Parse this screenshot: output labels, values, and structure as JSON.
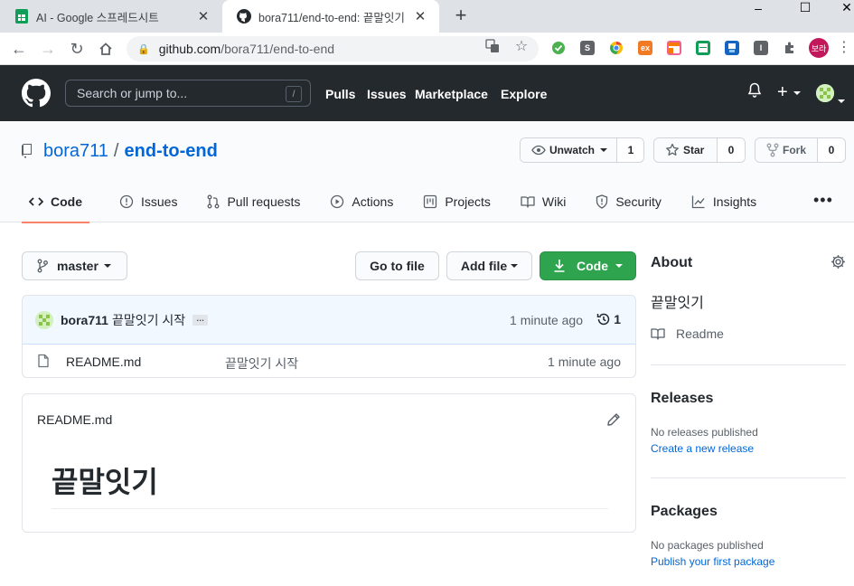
{
  "browser": {
    "tabs": [
      {
        "title": "AI - Google 스프레드시트",
        "active": false
      },
      {
        "title": "bora711/end-to-end: 끝말잇기",
        "active": true
      }
    ],
    "url_host": "github.com",
    "url_path": "/bora711/end-to-end",
    "profile_label": "보라",
    "extensions": [
      {
        "name": "ext-s-icon",
        "glyph": "S",
        "color": "#5f6368"
      },
      {
        "name": "ext-ex-icon",
        "glyph": "ex",
        "color": "#f07b24"
      },
      {
        "name": "ext-i-icon",
        "glyph": "I",
        "color": "#5f6368"
      }
    ]
  },
  "gh_header": {
    "search_placeholder": "Search or jump to...",
    "search_shortcut": "/",
    "nav": [
      "Pulls",
      "Issues",
      "Marketplace",
      "Explore"
    ]
  },
  "repo": {
    "owner": "bora711",
    "separator": "/",
    "name": "end-to-end",
    "watch_label": "Unwatch",
    "watch_count": "1",
    "star_label": "Star",
    "star_count": "0",
    "fork_label": "Fork",
    "fork_count": "0",
    "tabs": [
      "Code",
      "Issues",
      "Pull requests",
      "Actions",
      "Projects",
      "Wiki",
      "Security",
      "Insights"
    ]
  },
  "toolbar": {
    "branch": "master",
    "go_to_file": "Go to file",
    "add_file": "Add file",
    "code": "Code"
  },
  "commit": {
    "user": "bora711",
    "message": "끝말잇기 시작",
    "ellipsis": "…",
    "time": "1 minute ago",
    "count": "1"
  },
  "files": [
    {
      "name": "README.md",
      "message": "끝말잇기 시작",
      "time": "1 minute ago"
    }
  ],
  "readme": {
    "title": "README.md",
    "heading": "끝말잇기"
  },
  "sidebar": {
    "about_title": "About",
    "description": "끝말잇기",
    "readme_label": "Readme",
    "releases_title": "Releases",
    "releases_text": "No releases published",
    "releases_link": "Create a new release",
    "packages_title": "Packages",
    "packages_text": "No packages published",
    "packages_link": "Publish your first package"
  },
  "colors": {
    "header_bg": "#24292e",
    "link": "#0366d6",
    "green_button": "#2ea44f",
    "tab_underline": "#f9826c"
  }
}
